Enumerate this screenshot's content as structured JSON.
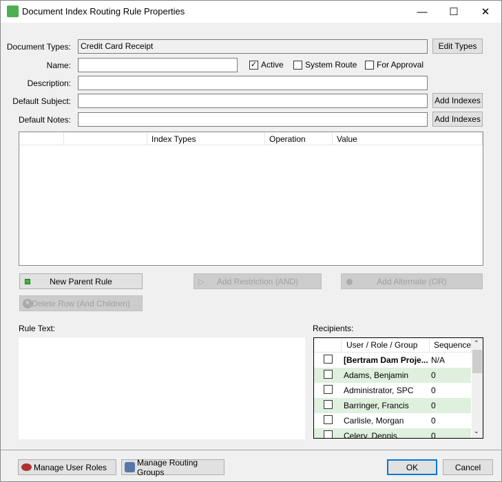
{
  "window": {
    "title": "Document Index Routing Rule Properties",
    "minimize": "—",
    "maximize": "☐",
    "close": "✕"
  },
  "form": {
    "document_types_label": "Document Types:",
    "document_types_value": "Credit Card Receipt",
    "edit_types": "Edit Types",
    "name_label": "Name:",
    "name_value": "",
    "active_label": "Active",
    "active_checked": true,
    "system_route_label": "System Route",
    "system_route_checked": false,
    "for_approval_label": "For Approval",
    "for_approval_checked": false,
    "description_label": "Description:",
    "description_value": "",
    "default_subject_label": "Default Subject:",
    "default_subject_value": "",
    "add_indexes_subject": "Add Indexes",
    "default_notes_label": "Default Notes:",
    "default_notes_value": "",
    "add_indexes_notes": "Add Indexes"
  },
  "rules_grid": {
    "columns": [
      "",
      "",
      "Index Types",
      "Operation",
      "Value"
    ]
  },
  "rule_buttons": {
    "new_parent": "New Parent Rule",
    "add_restriction": "Add Restriction (AND)",
    "add_alternate": "Add Alternate (OR)",
    "delete_row": "Delete Row (And Children)"
  },
  "rule_text": {
    "label": "Rule Text:",
    "value": ""
  },
  "recipients": {
    "label": "Recipients:",
    "columns": [
      "",
      "User / Role / Group",
      "Sequence"
    ],
    "rows": [
      {
        "name": "[Bertram Dam Proje...",
        "sequence": "N/A",
        "bold": true
      },
      {
        "name": "Adams, Benjamin",
        "sequence": "0"
      },
      {
        "name": "Administrator, SPC",
        "sequence": "0"
      },
      {
        "name": "Barringer, Francis",
        "sequence": "0"
      },
      {
        "name": "Carlisle, Morgan",
        "sequence": "0"
      },
      {
        "name": "Celery, Dennis",
        "sequence": "0"
      }
    ]
  },
  "footer": {
    "manage_user_roles": "Manage User Roles",
    "manage_routing_groups": "Manage Routing Groups",
    "ok": "OK",
    "cancel": "Cancel"
  },
  "colors": {
    "row_alt": "#dff0df",
    "ok_border": "#0078d7",
    "new_rule_icon": "#3cb43c"
  }
}
